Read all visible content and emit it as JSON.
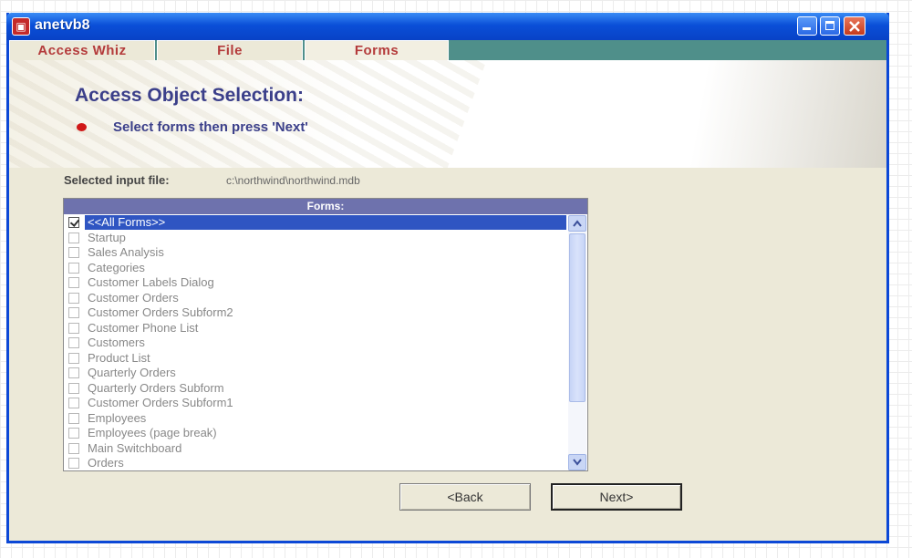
{
  "window": {
    "title": "anetvb8",
    "app_icon_glyph": "▣",
    "accent_color": "#0a4fd8"
  },
  "tabs": [
    {
      "label": "Access Whiz"
    },
    {
      "label": "File"
    },
    {
      "label": "Forms",
      "active": true
    }
  ],
  "banner": {
    "heading": "Access Object Selection:",
    "instruction": "Select forms then press 'Next'"
  },
  "input_file": {
    "label": "Selected input file:",
    "value": "c:\\northwind\\northwind.mdb"
  },
  "forms_list": {
    "header": "Forms:",
    "items": [
      {
        "label": "<<All Forms>>",
        "checked": true,
        "selected": true
      },
      {
        "label": "Startup",
        "checked": false
      },
      {
        "label": "Sales Analysis",
        "checked": false
      },
      {
        "label": "Categories",
        "checked": false
      },
      {
        "label": "Customer Labels Dialog",
        "checked": false
      },
      {
        "label": "Customer Orders",
        "checked": false
      },
      {
        "label": "Customer Orders Subform2",
        "checked": false
      },
      {
        "label": "Customer Phone List",
        "checked": false
      },
      {
        "label": "Customers",
        "checked": false
      },
      {
        "label": "Product List",
        "checked": false
      },
      {
        "label": "Quarterly Orders",
        "checked": false
      },
      {
        "label": "Quarterly Orders Subform",
        "checked": false
      },
      {
        "label": "Customer Orders Subform1",
        "checked": false
      },
      {
        "label": "Employees",
        "checked": false
      },
      {
        "label": "Employees (page break)",
        "checked": false
      },
      {
        "label": "Main Switchboard",
        "checked": false
      },
      {
        "label": "Orders",
        "checked": false
      }
    ]
  },
  "buttons": {
    "back": "<Back",
    "next": "Next>"
  }
}
